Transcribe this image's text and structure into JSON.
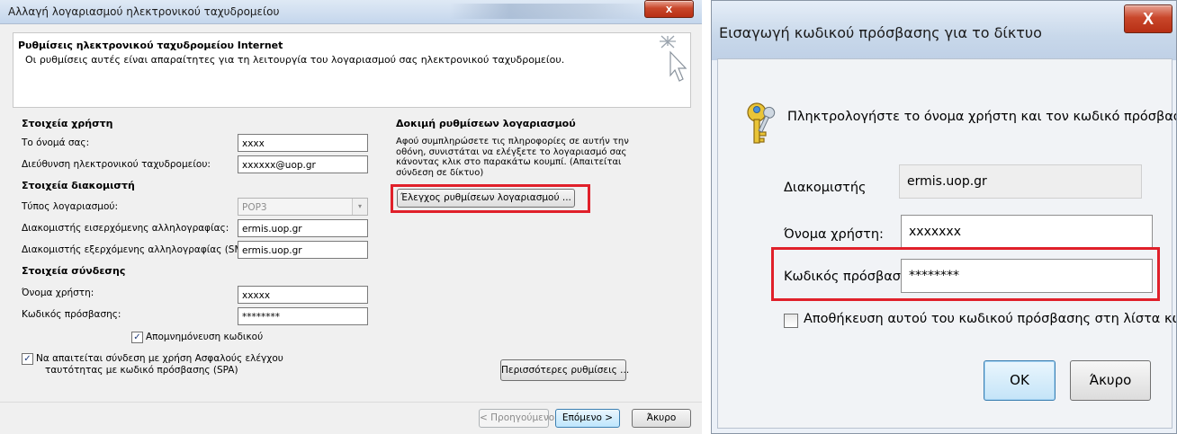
{
  "account_dialog": {
    "title": "Αλλαγή λογαριασμού ηλεκτρονικού ταχυδρομείου",
    "close_label": "x",
    "header": {
      "title": "Ρυθμίσεις ηλεκτρονικού ταχυδρομείου Internet",
      "subtitle": "Οι ρυθμίσεις αυτές είναι απαραίτητες για τη λειτουργία του λογαριασμού σας ηλεκτρονικού ταχυδρομείου."
    },
    "user_info": {
      "heading": "Στοιχεία χρήστη",
      "name_label": "Το όνομά σας:",
      "name_value": "xxxx",
      "email_label": "Διεύθυνση ηλεκτρονικού ταχυδρομείου:",
      "email_value": "xxxxxx@uop.gr"
    },
    "server_info": {
      "heading": "Στοιχεία διακομιστή",
      "account_type_label": "Τύπος λογαριασμού:",
      "account_type_value": "POP3",
      "incoming_label": "Διακομιστής εισερχόμενης αλληλογραφίας:",
      "incoming_value": "ermis.uop.gr",
      "outgoing_label": "Διακομιστής εξερχόμενης αλληλογραφίας (SMTP):",
      "outgoing_value": "ermis.uop.gr"
    },
    "login_info": {
      "heading": "Στοιχεία σύνδεσης",
      "username_label": "Όνομα χρήστη:",
      "username_value": "xxxxx",
      "password_label": "Κωδικός πρόσβασης:",
      "password_value": "********",
      "remember_label": "Απομνημόνευση κωδικού",
      "remember_checked": true,
      "spa_label_line1": "Να απαιτείται σύνδεση με χρήση Ασφαλούς ελέγχου",
      "spa_label_line2": "ταυτότητας με κωδικό πρόσβασης (SPA)",
      "spa_checked": true
    },
    "test": {
      "heading": "Δοκιμή ρυθμίσεων λογαριασμού",
      "description": "Αφού συμπληρώσετε τις πληροφορίες σε αυτήν την οθόνη, συνιστάται να ελέγξετε το λογαριασμό σας κάνοντας κλικ στο παρακάτω κουμπί. (Απαιτείται σύνδεση σε δίκτυο)",
      "button_label": "Έλεγχος ρυθμίσεων λογαριασμού ..."
    },
    "more_settings_label": "Περισσότερες ρυθμίσεις ...",
    "footer": {
      "back_label": "< Προηγούμενο",
      "next_label": "Επόμενο >",
      "cancel_label": "Άκυρο"
    }
  },
  "password_dialog": {
    "title": "Εισαγωγή κωδικού πρόσβασης για το δίκτυο",
    "close_label": "X",
    "prompt": "Πληκτρολογήστε το όνομα χρήστη και τον κωδικό πρόσβασης.",
    "server_label": "Διακομιστής",
    "server_value": "ermis.uop.gr",
    "username_label": "Όνομα χρήστη:",
    "username_value": "xxxxxxx",
    "password_label": "Κωδικός πρόσβασης:",
    "password_value": "********",
    "save_label": "Αποθήκευση αυτού του κωδικού πρόσβασης στη λίστα κωδικών",
    "save_checked": false,
    "ok_label": "OK",
    "cancel_label": "Άκυρο"
  },
  "icons": {
    "cursor_sparkle": "cursor-sparkle-icon",
    "keys": "keys-icon",
    "close": "close-icon",
    "checkmark": "✓",
    "dropdown_arrow": "▾"
  },
  "colors": {
    "highlight_red": "#e0202a",
    "close_red": "#c9472b",
    "title_blue": "#c8d8ea"
  }
}
